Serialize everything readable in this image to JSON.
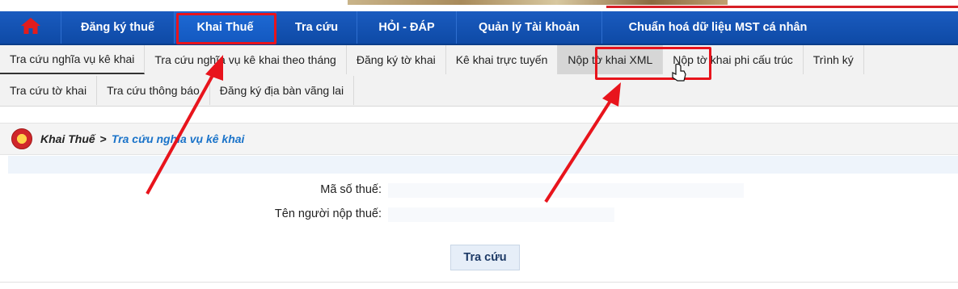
{
  "main_nav": {
    "items": [
      {
        "label": "Đăng ký thuế"
      },
      {
        "label": "Khai Thuế"
      },
      {
        "label": "Tra cứu"
      },
      {
        "label": "HỎI - ĐÁP"
      },
      {
        "label": "Quản lý Tài khoản"
      },
      {
        "label": "Chuẩn hoá dữ liệu MST cá nhân"
      }
    ]
  },
  "sub_nav": {
    "row1": [
      {
        "label": "Tra cứu nghĩa vụ kê khai"
      },
      {
        "label": "Tra cứu nghĩa vụ kê khai theo tháng"
      },
      {
        "label": "Đăng ký tờ khai"
      },
      {
        "label": "Kê khai trực tuyến"
      },
      {
        "label": "Nộp tờ khai XML"
      },
      {
        "label": "Nộp tờ khai phi cấu trúc"
      },
      {
        "label": "Trình ký"
      }
    ],
    "row2": [
      {
        "label": "Tra cứu tờ khai"
      },
      {
        "label": "Tra cứu thông báo"
      },
      {
        "label": "Đăng ký địa bàn vãng lai"
      }
    ]
  },
  "breadcrumb": {
    "root": "Khai Thuế",
    "separator": ">",
    "current": "Tra cứu nghĩa vụ kê khai"
  },
  "form": {
    "tax_code_label": "Mã số thuế:",
    "taxpayer_name_label": "Tên người nộp thuế:",
    "search_button": "Tra cứu"
  },
  "colors": {
    "nav_blue": "#1a5bbf",
    "annotation_red": "#e8141c",
    "breadcrumb_link": "#1a73c9"
  }
}
